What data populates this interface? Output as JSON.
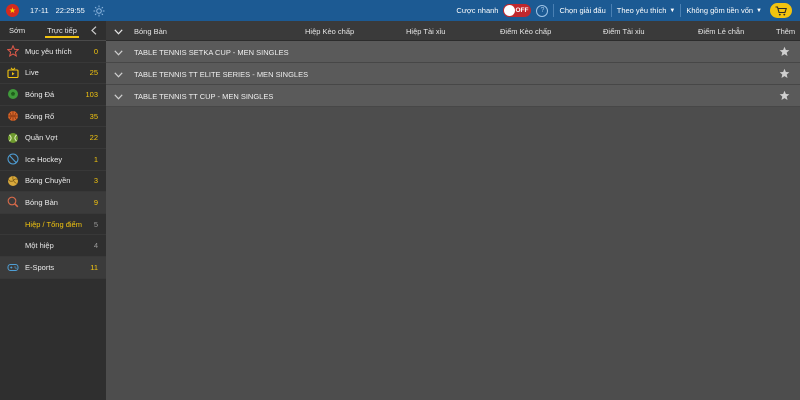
{
  "header": {
    "date": "17-11",
    "time": "22:29:55",
    "quick_bet_label": "Cược nhanh",
    "quick_bet_toggle": "OFF",
    "help_label": "?",
    "select_league_label": "Chọn giải đấu",
    "favorites_dropdown_label": "Theo yêu thích",
    "capital_dropdown_label": "Không gồm tiền vốn"
  },
  "sidebar": {
    "tab_early": "Sớm",
    "tab_live": "Trực tiếp",
    "items": [
      {
        "label": "Mục yêu thích",
        "count": "0",
        "icon": "star-icon"
      },
      {
        "label": "Live",
        "count": "25",
        "icon": "tv-icon"
      },
      {
        "label": "Bóng Đá",
        "count": "103",
        "icon": "soccer-ball-icon"
      },
      {
        "label": "Bóng Rổ",
        "count": "35",
        "icon": "basketball-icon"
      },
      {
        "label": "Quần Vợt",
        "count": "22",
        "icon": "tennis-ball-icon"
      },
      {
        "label": "Ice Hockey",
        "count": "1",
        "icon": "ice-hockey-icon"
      },
      {
        "label": "Bóng Chuyền",
        "count": "3",
        "icon": "volleyball-icon"
      },
      {
        "label": "Bóng Bàn",
        "count": "9",
        "icon": "table-tennis-icon"
      },
      {
        "label": "E-Sports",
        "count": "11",
        "icon": "gamepad-icon"
      }
    ],
    "subitems": [
      {
        "label": "Hiệp / Tổng điểm",
        "count": "5"
      },
      {
        "label": "Một hiệp",
        "count": "4"
      }
    ]
  },
  "table": {
    "columns": {
      "sport": "Bóng Bàn",
      "set_handicap": "Hiệp Kèo chấp",
      "set_over_under": "Hiệp Tài xỉu",
      "point_handicap": "Điểm Kèo chấp",
      "point_over_under": "Điểm Tài xỉu",
      "point_odd_even": "Điểm Lẻ chẵn",
      "more": "Thêm"
    },
    "leagues": [
      "TABLE TENNIS SETKA CUP - MEN SINGLES",
      "TABLE TENNIS TT ELITE SERIES - MEN SINGLES",
      "TABLE TENNIS TT CUP - MEN SINGLES"
    ]
  },
  "colors": {
    "topbar": "#1c5a93",
    "accent": "#f2c40f",
    "toggle_off": "#c0282d"
  }
}
